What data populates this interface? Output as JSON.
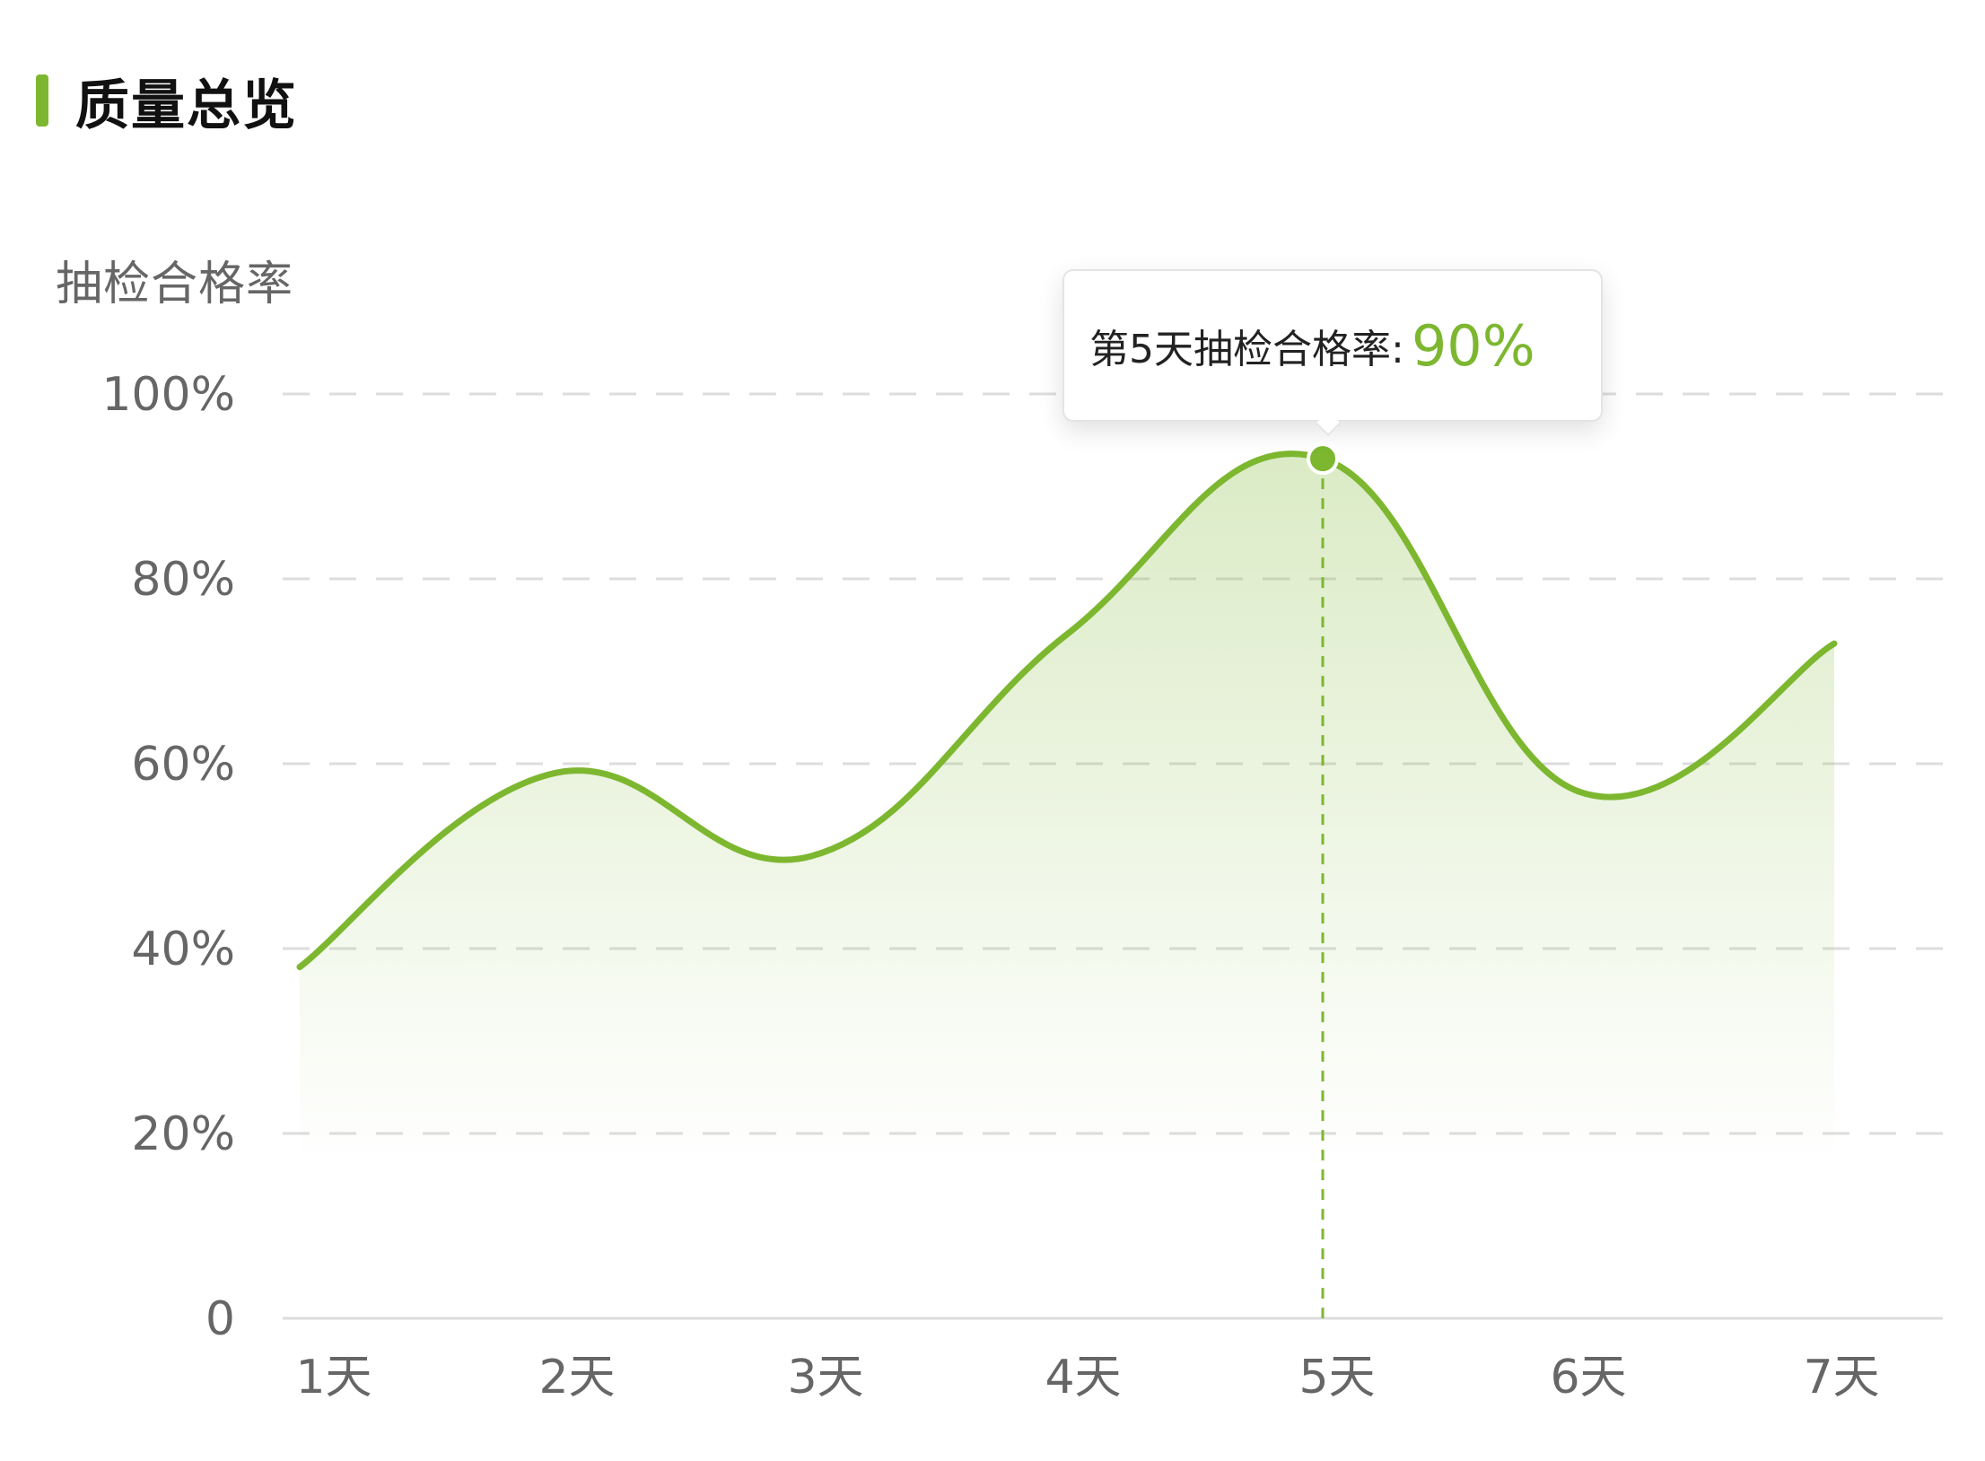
{
  "header": {
    "title": "质量总览"
  },
  "colors": {
    "accent": "#7db730",
    "grid": "#dddddd",
    "axis": "#dddddd",
    "tick_text": "#666666"
  },
  "tooltip": {
    "label": "第5天抽检合格率:",
    "value": "90%"
  },
  "chart_data": {
    "type": "area",
    "title": "",
    "ylabel": "抽检合格率",
    "xlabel": "",
    "categories": [
      "1天",
      "2天",
      "3天",
      "4天",
      "5天",
      "6天",
      "7天"
    ],
    "y_ticks": [
      "0",
      "20%",
      "40%",
      "60%",
      "80%",
      "100%"
    ],
    "ylim": [
      0,
      100
    ],
    "grid": true,
    "series": [
      {
        "values": [
          38,
          59,
          50,
          74,
          93,
          57,
          73
        ]
      }
    ],
    "highlight": {
      "category": "5天",
      "value_label": "90%"
    }
  }
}
